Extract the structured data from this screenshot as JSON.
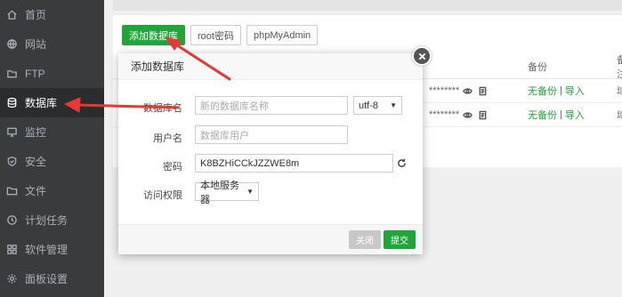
{
  "sidebar": {
    "items": [
      {
        "label": "首页",
        "icon": "home-icon"
      },
      {
        "label": "网站",
        "icon": "globe-icon"
      },
      {
        "label": "FTP",
        "icon": "ftp-icon"
      },
      {
        "label": "数据库",
        "icon": "database-icon",
        "active": true
      },
      {
        "label": "监控",
        "icon": "monitor-icon"
      },
      {
        "label": "安全",
        "icon": "shield-icon"
      },
      {
        "label": "文件",
        "icon": "folder-icon"
      },
      {
        "label": "计划任务",
        "icon": "clock-icon"
      },
      {
        "label": "软件管理",
        "icon": "grid-icon"
      },
      {
        "label": "面板设置",
        "icon": "gear-icon"
      }
    ]
  },
  "toolbar": {
    "add_db": "添加数据库",
    "root_pw": "root密码",
    "phpmyadmin": "phpMyAdmin"
  },
  "table": {
    "headers": {
      "backup": "备份",
      "tail": "备注"
    },
    "rows": [
      {
        "pw_mask": "********",
        "no_backup": "无备份",
        "sep": "|",
        "import": "导入",
        "tail": "域"
      },
      {
        "pw_mask": "********",
        "no_backup": "无备份",
        "sep": "|",
        "import": "导入",
        "tail": "域"
      }
    ]
  },
  "modal": {
    "title": "添加数据库",
    "db_name_label": "数据库名",
    "db_name_placeholder": "新的数据库名称",
    "charset": "utf-8",
    "user_label": "用户名",
    "user_placeholder": "数据库用户",
    "password_label": "密码",
    "password_value": "K8BZHiCCkJZZWE8m",
    "access_label": "访问权限",
    "access_value": "本地服务器",
    "close_button": "关闭",
    "submit_button": "提交"
  },
  "colors": {
    "accent": "#20a53a",
    "sidebar_bg": "#3a3b3d",
    "arrow": "#e53935"
  }
}
